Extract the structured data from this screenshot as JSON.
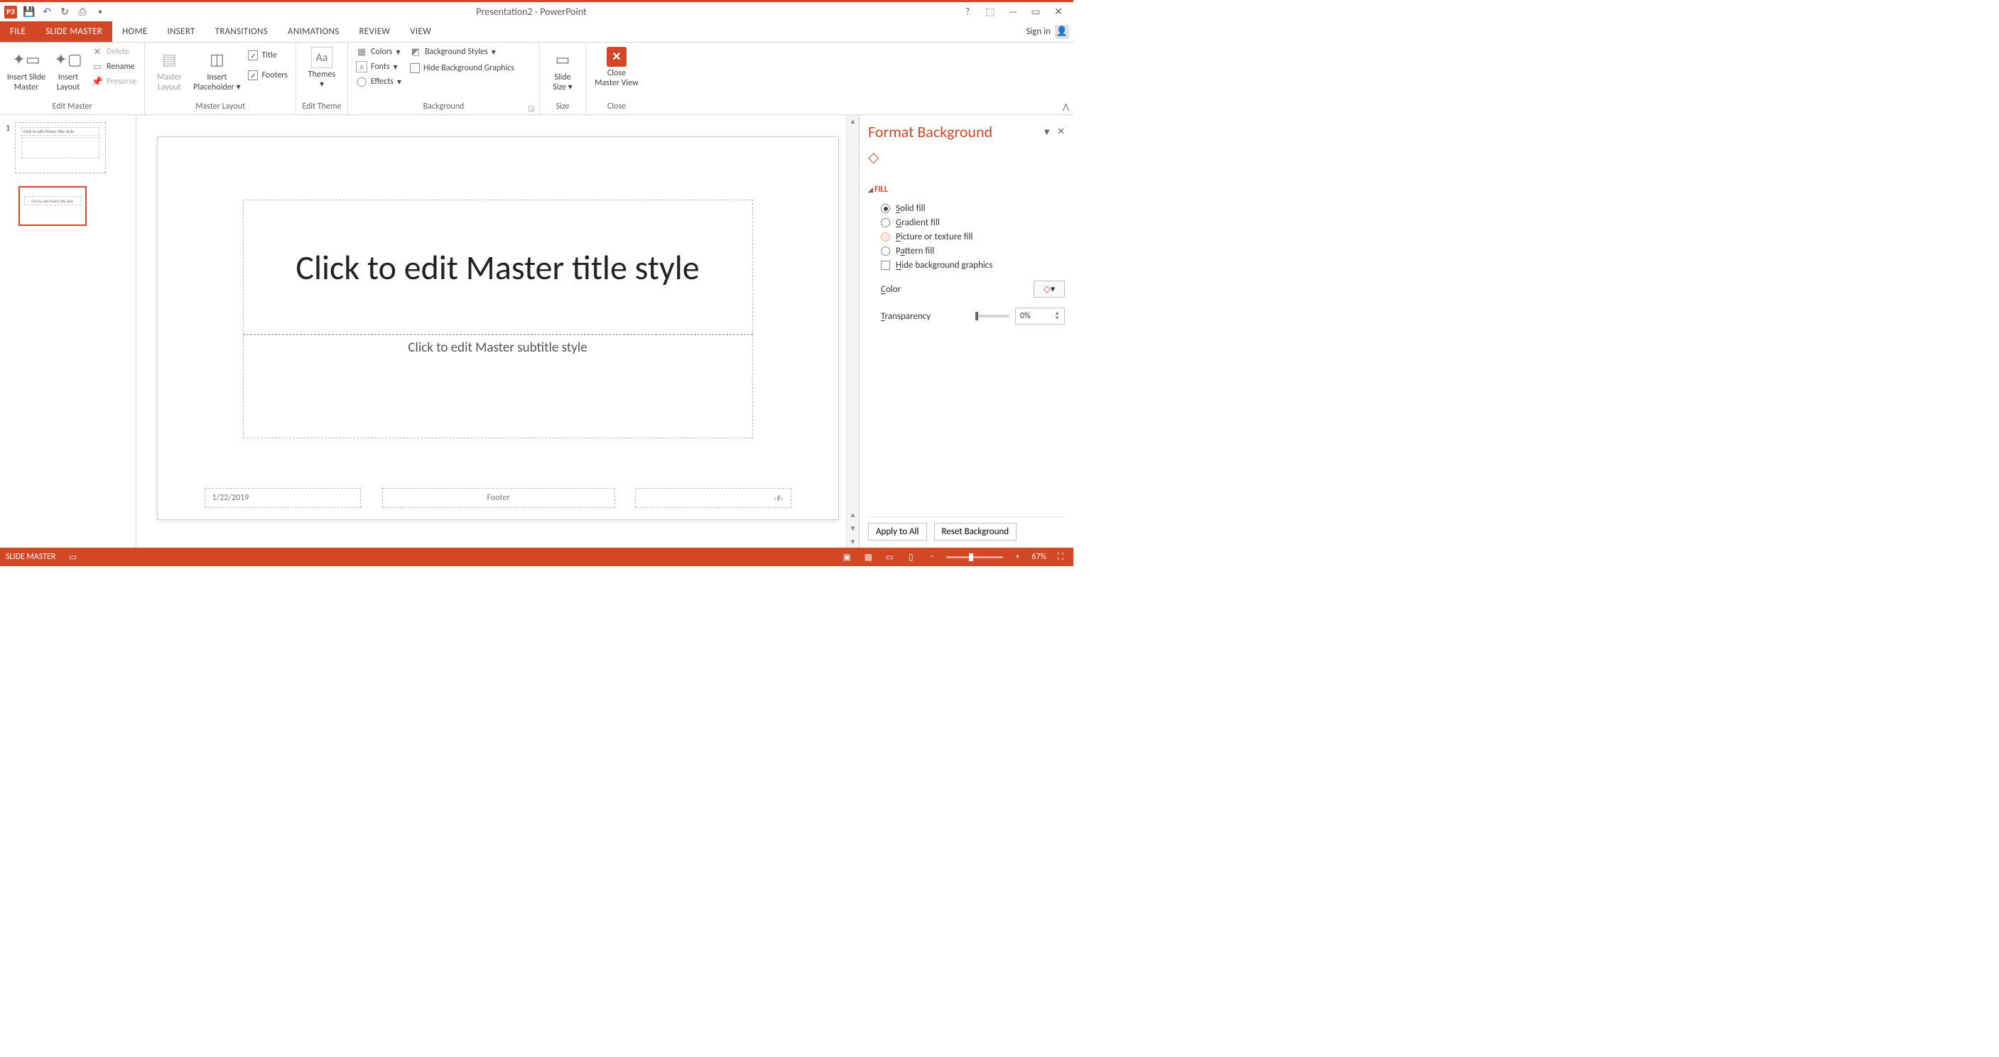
{
  "app": {
    "title": "Presentation2 - PowerPoint",
    "logo": "P3"
  },
  "qat": {
    "save": "💾",
    "undo": "↶",
    "redo": "↻",
    "start": "⎙",
    "more": "▾"
  },
  "win": {
    "help": "?",
    "opts": "⬚",
    "min": "—",
    "max": "▭",
    "close": "✕"
  },
  "tabs": {
    "file": "FILE",
    "slide_master": "SLIDE MASTER",
    "home": "HOME",
    "insert": "INSERT",
    "transitions": "TRANSITIONS",
    "animations": "ANIMATIONS",
    "review": "REVIEW",
    "view": "VIEW",
    "signin": "Sign in"
  },
  "ribbon": {
    "edit_master": {
      "label": "Edit Master",
      "insert_slide_master": "Insert Slide\nMaster",
      "insert_layout": "Insert\nLayout",
      "delete": "Delete",
      "rename": "Rename",
      "preserve": "Preserve"
    },
    "master_layout": {
      "label": "Master Layout",
      "master_layout_btn": "Master\nLayout",
      "insert_placeholder": "Insert\nPlaceholder",
      "title_chk": "Title",
      "footers_chk": "Footers"
    },
    "edit_theme": {
      "label": "Edit Theme",
      "themes": "Themes"
    },
    "background": {
      "label": "Background",
      "colors": "Colors",
      "fonts": "Fonts",
      "effects": "Effects",
      "bg_styles": "Background Styles",
      "hide_bg": "Hide Background Graphics"
    },
    "size": {
      "label": "Size",
      "slide_size": "Slide\nSize"
    },
    "close": {
      "label": "Close",
      "close_mv": "Close\nMaster View"
    }
  },
  "thumbs": {
    "slide_num": "1",
    "master_text": "Click to edit Master title style",
    "layout_text": "Click to edit Master title style"
  },
  "slide": {
    "title": "Click to edit Master title style",
    "subtitle": "Click to edit Master subtitle style",
    "date": "1/22/2019",
    "footer": "Footer",
    "num": "‹#›"
  },
  "pane": {
    "title": "Format Background",
    "section": "FILL",
    "solid": "Solid fill",
    "gradient": "Gradient fill",
    "picture": "Picture or texture fill",
    "pattern": "Pattern fill",
    "hide": "Hide background graphics",
    "color_lbl": "Color",
    "transparency_lbl": "Transparency",
    "transparency_val": "0%",
    "apply_all": "Apply to All",
    "reset": "Reset Background"
  },
  "status": {
    "mode": "SLIDE MASTER",
    "zoom": "67%",
    "zoom_minus": "−",
    "zoom_plus": "+",
    "fit": "⛶"
  }
}
